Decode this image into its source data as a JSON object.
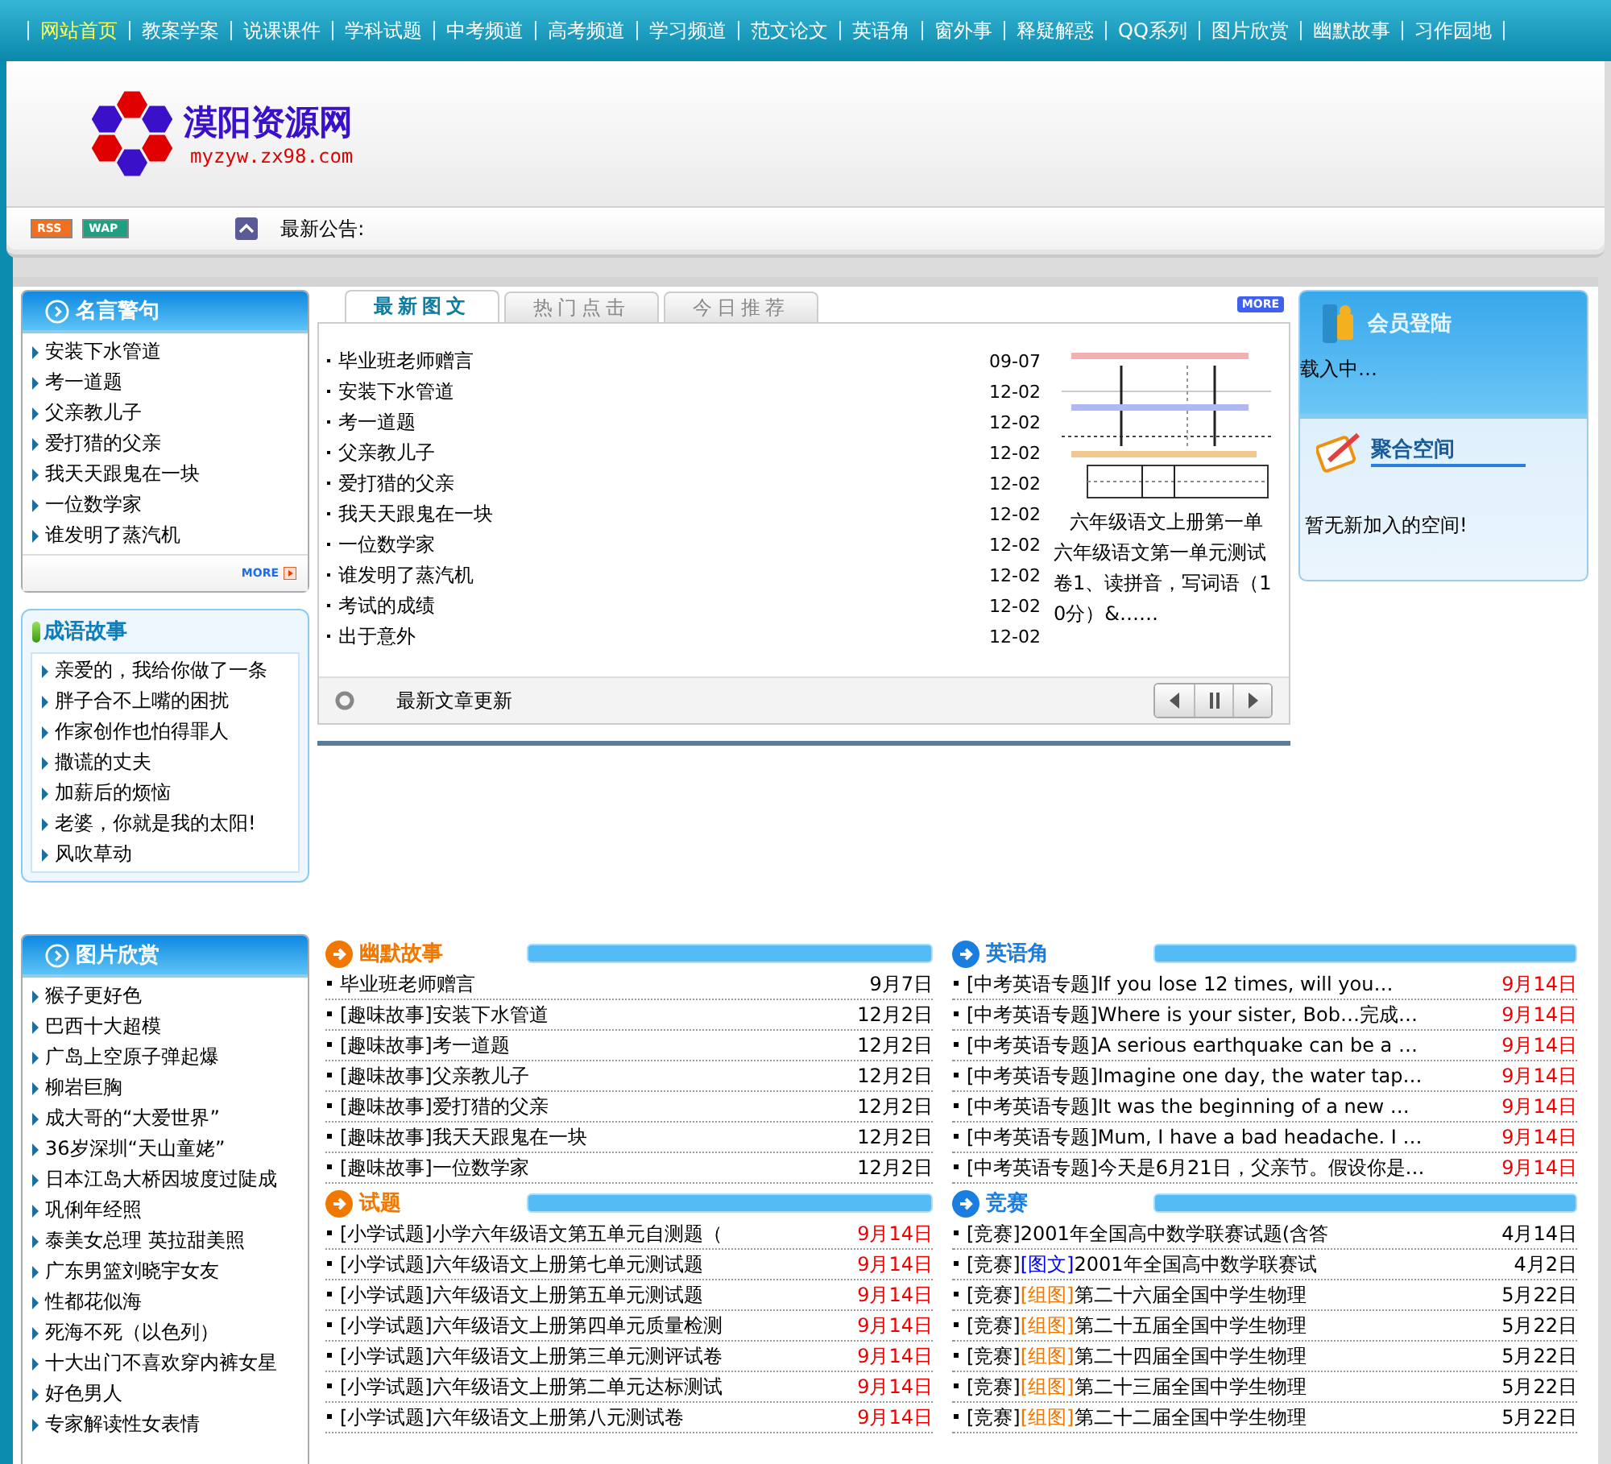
{
  "nav": [
    {
      "label": "网站首页",
      "selected": true
    },
    {
      "label": "教案学案",
      "selected": false
    },
    {
      "label": "说课课件",
      "selected": false
    },
    {
      "label": "学科试题",
      "selected": false
    },
    {
      "label": "中考频道",
      "selected": false
    },
    {
      "label": "高考频道",
      "selected": false
    },
    {
      "label": "学习频道",
      "selected": false
    },
    {
      "label": "范文论文",
      "selected": false
    },
    {
      "label": "英语角",
      "selected": false
    },
    {
      "label": "窗外事",
      "selected": false
    },
    {
      "label": "释疑解惑",
      "selected": false
    },
    {
      "label": "QQ系列",
      "selected": false
    },
    {
      "label": "图片欣赏",
      "selected": false
    },
    {
      "label": "幽默故事",
      "selected": false
    },
    {
      "label": "习作园地",
      "selected": false
    }
  ],
  "site": {
    "name": "漠阳资源网",
    "domain": "myzyw.zx98.com"
  },
  "badges": [
    "RSS",
    "WAP"
  ],
  "notice": {
    "label": "最新公告:"
  },
  "sidebar": [
    {
      "kind": "panel",
      "title": "名言警句",
      "more": "MORE",
      "items": [
        "安装下水管道",
        "考一道题",
        "父亲教儿子",
        "爱打猎的父亲",
        "我天天跟鬼在一块",
        "一位数学家",
        "谁发明了蒸汽机"
      ]
    },
    {
      "kind": "framed",
      "title": "成语故事",
      "items": [
        "亲爱的，我给你做了一条",
        "胖子合不上嘴的困扰",
        "作家创作也怕得罪人",
        "撒谎的丈夫",
        "加薪后的烦恼",
        "老婆，你就是我的太阳!",
        "风吹草动"
      ]
    },
    {
      "kind": "panel",
      "title": "图片欣赏",
      "items": [
        "猴子更好色",
        "巴西十大超模",
        "广岛上空原子弹起爆",
        "柳岩巨胸",
        "成大哥的“大爱世界”",
        "36岁深圳“天山童姥”",
        "日本江岛大桥因坡度过陡成",
        "巩俐年经照",
        "泰美女总理 英拉甜美照",
        "广东男篮刘晓宇女友",
        "性都花似海",
        "死海不死（以色列）",
        "十大出门不喜欢穿内裤女星",
        "好色男人",
        "专家解读性女表情"
      ]
    }
  ],
  "featured": {
    "tabs": [
      {
        "label": "最新图文",
        "selected": true
      },
      {
        "label": "热门点击",
        "selected": false
      },
      {
        "label": "今日推荐",
        "selected": false
      }
    ],
    "more": "MORE",
    "articles": [
      {
        "title": "毕业班老师赠言",
        "date": "09-07"
      },
      {
        "title": "安装下水管道",
        "date": "12-02"
      },
      {
        "title": "考一道题",
        "date": "12-02"
      },
      {
        "title": "父亲教儿子",
        "date": "12-02"
      },
      {
        "title": "爱打猎的父亲",
        "date": "12-02"
      },
      {
        "title": "我天天跟鬼在一块",
        "date": "12-02"
      },
      {
        "title": "一位数学家",
        "date": "12-02"
      },
      {
        "title": "谁发明了蒸汽机",
        "date": "12-02"
      },
      {
        "title": "考试的成绩",
        "date": "12-02"
      },
      {
        "title": "出于意外",
        "date": "12-02"
      }
    ],
    "caption": "六年级语文上册第一单",
    "summary": "六年级语文第一单元测试卷1、读拼音，写词语（10分）&……",
    "footer": "最新文章更新"
  },
  "login": {
    "title": "会员登陆",
    "status": "载入中…"
  },
  "spaces": {
    "title": "聚合空间",
    "message": "暂无新加入的空间!"
  },
  "sections": [
    {
      "title": "幽默故事",
      "color": "#f07800",
      "items": [
        {
          "title": "毕业班老师赠言",
          "date": "9月7日",
          "highlighted": false
        },
        {
          "category": "[趣味故事]",
          "title": "安装下水管道",
          "date": "12月2日",
          "highlighted": false
        },
        {
          "category": "[趣味故事]",
          "title": "考一道题",
          "date": "12月2日",
          "highlighted": false
        },
        {
          "category": "[趣味故事]",
          "title": "父亲教儿子",
          "date": "12月2日",
          "highlighted": false
        },
        {
          "category": "[趣味故事]",
          "title": "爱打猎的父亲",
          "date": "12月2日",
          "highlighted": false
        },
        {
          "category": "[趣味故事]",
          "title": "我天天跟鬼在一块",
          "date": "12月2日",
          "highlighted": false
        },
        {
          "category": "[趣味故事]",
          "title": "一位数学家",
          "date": "12月2日",
          "highlighted": false
        }
      ]
    },
    {
      "title": "英语角",
      "color": "#1a7de0",
      "items": [
        {
          "category": "[中考英语专题]",
          "title": "If you lose 12 times, will you…",
          "date": "9月14日",
          "highlighted": true
        },
        {
          "category": "[中考英语专题]",
          "title": "Where is your sister, Bob…完成…",
          "date": "9月14日",
          "highlighted": true
        },
        {
          "category": "[中考英语专题]",
          "title": "A serious earthquake can be a …",
          "date": "9月14日",
          "highlighted": true
        },
        {
          "category": "[中考英语专题]",
          "title": "Imagine one day, the water tap…",
          "date": "9月14日",
          "highlighted": true
        },
        {
          "category": "[中考英语专题]",
          "title": "It was the beginning of a new …",
          "date": "9月14日",
          "highlighted": true
        },
        {
          "category": "[中考英语专题]",
          "title": "Mum, I have a bad headache. I …",
          "date": "9月14日",
          "highlighted": true
        },
        {
          "category": "[中考英语专题]",
          "title": "今天是6月21日，父亲节。假设你是…",
          "date": "9月14日",
          "highlighted": true
        }
      ]
    },
    {
      "title": "试题",
      "color": "#f07800",
      "items": [
        {
          "category": "[小学试题]",
          "title": "小学六年级语文第五单元自测题（",
          "date": "9月14日",
          "highlighted": true
        },
        {
          "category": "[小学试题]",
          "title": "六年级语文上册第七单元测试题",
          "date": "9月14日",
          "highlighted": true
        },
        {
          "category": "[小学试题]",
          "title": "六年级语文上册第五单元测试题",
          "date": "9月14日",
          "highlighted": true
        },
        {
          "category": "[小学试题]",
          "title": "六年级语文上册第四单元质量检测",
          "date": "9月14日",
          "highlighted": true
        },
        {
          "category": "[小学试题]",
          "title": "六年级语文上册第三单元测评试卷",
          "date": "9月14日",
          "highlighted": true
        },
        {
          "category": "[小学试题]",
          "title": "六年级语文上册第二单元达标测试",
          "date": "9月14日",
          "highlighted": true
        },
        {
          "category": "[小学试题]",
          "title": "六年级语文上册第八元测试卷",
          "date": "9月14日",
          "highlighted": true
        }
      ]
    },
    {
      "title": "竞赛",
      "color": "#1a7de0",
      "items": [
        {
          "category": "[竞赛]",
          "title": "2001年全国高中数学联赛试题(含答",
          "date": "4月14日",
          "highlighted": false
        },
        {
          "category": "[竞赛]",
          "tag": {
            "text": "[图文]",
            "color": "#0000ee"
          },
          "title": "2001年全国高中数学联赛试",
          "date": "4月2日",
          "highlighted": false
        },
        {
          "category": "[竞赛]",
          "tag": {
            "text": "[组图]",
            "color": "#f07800"
          },
          "title": "第二十六届全国中学生物理",
          "date": "5月22日",
          "highlighted": false
        },
        {
          "category": "[竞赛]",
          "tag": {
            "text": "[组图]",
            "color": "#f07800"
          },
          "title": "第二十五届全国中学生物理",
          "date": "5月22日",
          "highlighted": false
        },
        {
          "category": "[竞赛]",
          "tag": {
            "text": "[组图]",
            "color": "#f07800"
          },
          "title": "第二十四届全国中学生物理",
          "date": "5月22日",
          "highlighted": false
        },
        {
          "category": "[竞赛]",
          "tag": {
            "text": "[组图]",
            "color": "#f07800"
          },
          "title": "第二十三届全国中学生物理",
          "date": "5月22日",
          "highlighted": false
        },
        {
          "category": "[竞赛]",
          "tag": {
            "text": "[组图]",
            "color": "#f07800"
          },
          "title": "第二十二届全国中学生物理",
          "date": "5月22日",
          "highlighted": false
        }
      ]
    }
  ]
}
